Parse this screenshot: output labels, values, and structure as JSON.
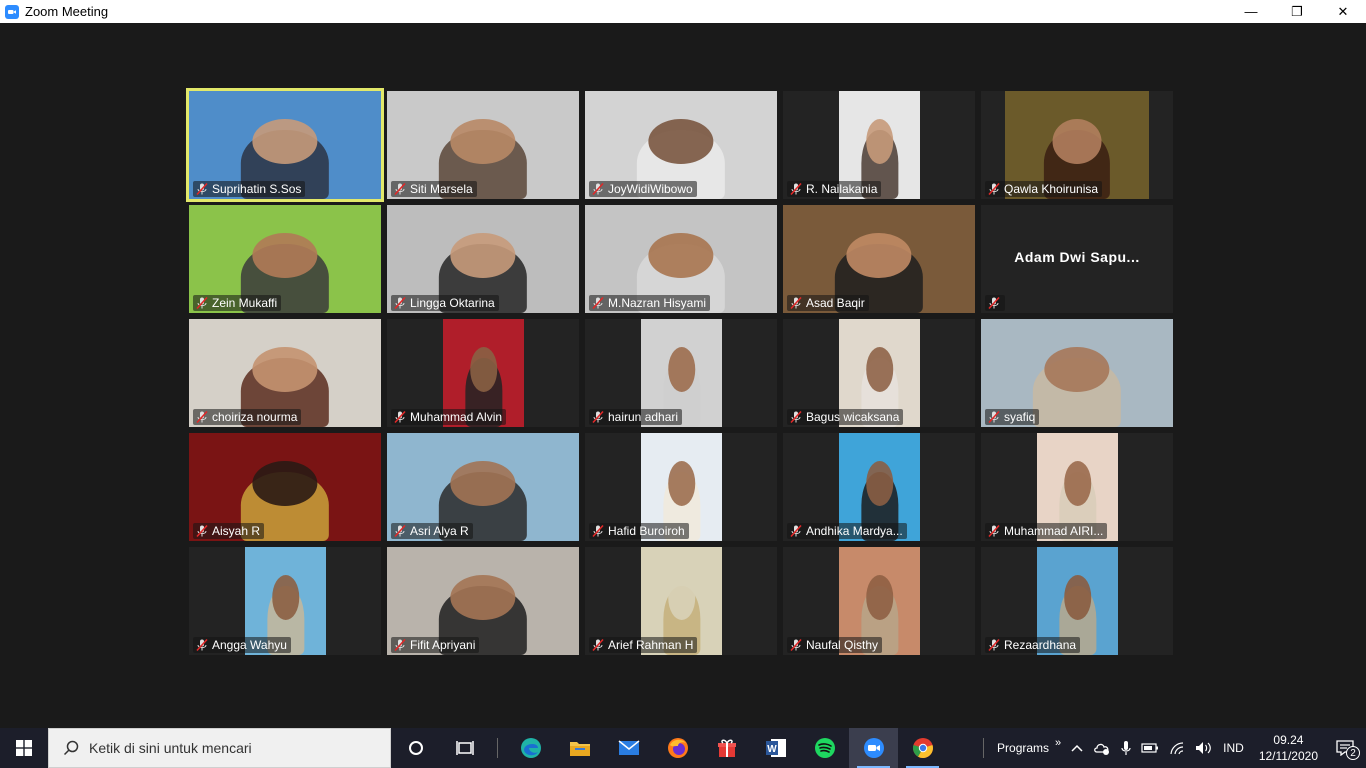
{
  "window": {
    "title": "Zoom Meeting",
    "controls": {
      "minimize": "—",
      "restore": "❐",
      "close": "✕"
    }
  },
  "participants": [
    {
      "name": "Suprihatin S.Sos",
      "active": true,
      "video": "full",
      "bg": "#4f8dc9",
      "fg": "#2b3444",
      "skin": "#c79a7a"
    },
    {
      "name": "Siti Marsela",
      "video": "full",
      "bg": "#c9c9c9",
      "fg": "#5b4638",
      "skin": "#b88866"
    },
    {
      "name": "JoyWidiWibowo",
      "video": "full",
      "bg": "#d3d3d3",
      "fg": "#eaeaea",
      "skin": "#7a5640"
    },
    {
      "name": "R. Nailakania",
      "video": "center",
      "bg": "#e6e6e6",
      "fg": "#4a3b33",
      "skin": "#c79a7a"
    },
    {
      "name": "Qawla Khoirunisa",
      "video": "center-wide",
      "bg": "#6b5a2a",
      "fg": "#3a1e12",
      "skin": "#b17e5d"
    },
    {
      "name": "Zein Mukaffi",
      "video": "full",
      "bg": "#8bc34a",
      "fg": "#3b3b3b",
      "skin": "#b07a56"
    },
    {
      "name": "Lingga Oktarina",
      "video": "full",
      "bg": "#bdbdbd",
      "fg": "#262626",
      "skin": "#c79a7a"
    },
    {
      "name": "M.Nazran Hisyami",
      "video": "full",
      "bg": "#c4c4c4",
      "fg": "#d9d9d9",
      "skin": "#a97650"
    },
    {
      "name": "Asad Baqir",
      "video": "full",
      "bg": "#7a5a3a",
      "fg": "#1e1e1e",
      "skin": "#c08a64"
    },
    {
      "name": "Adam Dwi Sapu...",
      "video": "none"
    },
    {
      "name": "choiriza nourma",
      "video": "full",
      "bg": "#d5d0c8",
      "fg": "#5a2d1f",
      "skin": "#c49270"
    },
    {
      "name": "Muhammad Alvin",
      "video": "center",
      "bg": "#b01e2a",
      "fg": "#232323",
      "skin": "#8a6044"
    },
    {
      "name": "hairun adhari",
      "video": "center",
      "bg": "#d1d1d1",
      "fg": "#cfcfcf",
      "skin": "#9c6d4e"
    },
    {
      "name": "Bagus wicaksana",
      "video": "center",
      "bg": "#e0d8cc",
      "fg": "#e6e2dc",
      "skin": "#8f6448"
    },
    {
      "name": "syafiq",
      "video": "full",
      "bg": "#a9b8c2",
      "fg": "#c8b9a2",
      "skin": "#a6785a"
    },
    {
      "name": "Aisyah R",
      "video": "full",
      "bg": "#7a1414",
      "fg": "#c9a13a",
      "skin": "#2a1a14"
    },
    {
      "name": "Asri Alya R",
      "video": "full",
      "bg": "#8fb6cf",
      "fg": "#2b2b2b",
      "skin": "#a27354"
    },
    {
      "name": "Hafid Buroiroh",
      "video": "center",
      "bg": "#e6ecf2",
      "fg": "#f0eadc",
      "skin": "#9c6f50"
    },
    {
      "name": "Andhika Mardya...",
      "video": "center",
      "bg": "#3fa4d9",
      "fg": "#1c1c1c",
      "skin": "#8a5e44"
    },
    {
      "name": "Muhammad AIRI...",
      "video": "center",
      "bg": "#e8d4c6",
      "fg": "#d8ccb8",
      "skin": "#9a6a4c"
    },
    {
      "name": "Angga Wahyu",
      "video": "center",
      "bg": "#6fb3d9",
      "fg": "#c7b79a",
      "skin": "#8c5f42"
    },
    {
      "name": "Fifit Apriyani",
      "video": "full",
      "bg": "#b9b3ab",
      "fg": "#1f1f1f",
      "skin": "#a47454"
    },
    {
      "name": "Arief Rahman H",
      "video": "center",
      "bg": "#d8d2b8",
      "fg": "#c6b07a",
      "skin": "#d8d2b8"
    },
    {
      "name": "Naufal Qisthy",
      "video": "center",
      "bg": "#c78a6a",
      "fg": "#b7a588",
      "skin": "#8f5f44"
    },
    {
      "name": "Rezaardhana",
      "video": "center",
      "bg": "#5aa3d0",
      "fg": "#b9a98d",
      "skin": "#8a5c40"
    }
  ],
  "taskbar": {
    "search_placeholder": "Ketik di sini untuk mencari",
    "programs_label": "Programs",
    "language": "IND",
    "time": "09.24",
    "date": "12/11/2020",
    "notifications": "2"
  }
}
